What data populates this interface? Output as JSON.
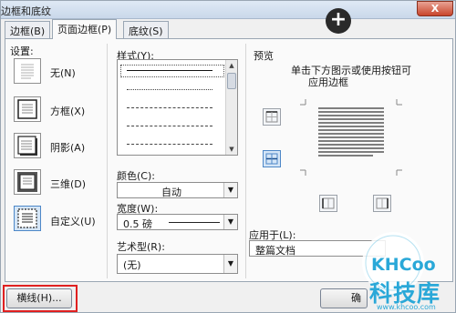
{
  "window": {
    "title": "边框和底纹",
    "close_glyph": "X"
  },
  "tabs": [
    {
      "label": "边框(B)"
    },
    {
      "label": "页面边框(P)"
    },
    {
      "label": "底纹(S)"
    }
  ],
  "settings": {
    "heading": "设置:",
    "items": [
      {
        "label": "无(N)",
        "icon": "none-border-icon"
      },
      {
        "label": "方框(X)",
        "icon": "box-border-icon"
      },
      {
        "label": "阴影(A)",
        "icon": "shadow-border-icon"
      },
      {
        "label": "三维(D)",
        "icon": "3d-border-icon"
      },
      {
        "label": "自定义(U)",
        "icon": "custom-border-icon"
      }
    ]
  },
  "style": {
    "heading": "样式(Y):"
  },
  "color": {
    "label": "颜色(C):",
    "value": "自动"
  },
  "width": {
    "label": "宽度(W):",
    "value": "0.5 磅"
  },
  "art": {
    "label": "艺术型(R):",
    "value": "(无)"
  },
  "preview": {
    "heading": "预览",
    "instruction_line1": "单击下方图示或使用按钮可",
    "instruction_line2": "应用边框"
  },
  "apply_to": {
    "label": "应用于(L):",
    "value": "整篇文档"
  },
  "buttons": {
    "horizontal_line": "横线(H)...",
    "ok_partial": "确"
  },
  "watermark": {
    "brand": "KHCoo",
    "cn_text": "科技库",
    "url": "www.khcoo.com"
  },
  "colors": {
    "accent": "#4d87c7",
    "highlight_box": "#e02020",
    "watermark_blue": "#2aa8d8"
  }
}
